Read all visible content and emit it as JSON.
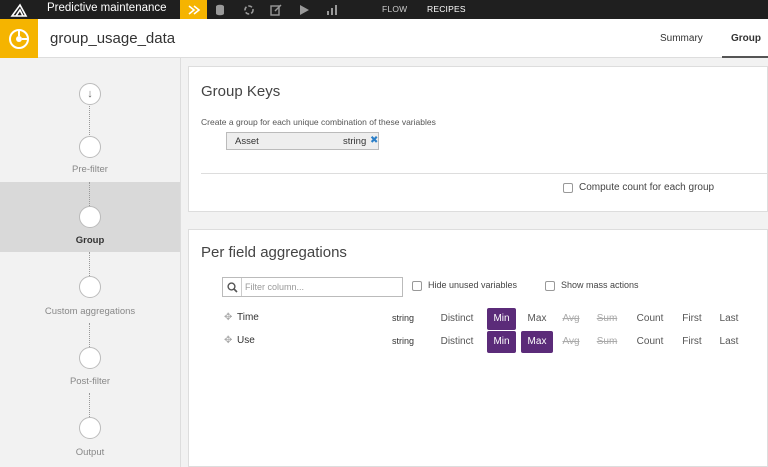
{
  "topbar": {
    "project_name": "Predictive maintenance",
    "nav": {
      "flow": "FLOW",
      "recipes": "RECIPES"
    },
    "icons": [
      "recipe-icon",
      "datasets-icon",
      "refresh-icon",
      "notebook-icon",
      "play-icon",
      "chart-icon"
    ]
  },
  "header": {
    "dataset_name": "group_usage_data",
    "tabs": {
      "summary": "Summary",
      "group": "Group"
    }
  },
  "steps": [
    {
      "label": ""
    },
    {
      "label": "Pre-filter"
    },
    {
      "label": "Group"
    },
    {
      "label": "Custom aggregations"
    },
    {
      "label": "Post-filter"
    },
    {
      "label": "Output"
    }
  ],
  "group_keys": {
    "title": "Group Keys",
    "hint": "Create a group for each unique combination of these variables",
    "key": {
      "name": "Asset",
      "type": "string"
    },
    "compute_count_label": "Compute count for each group"
  },
  "aggregations": {
    "title": "Per field aggregations",
    "filter_placeholder": "Filter column...",
    "hide_unused_label": "Hide unused variables",
    "show_mass_label": "Show mass actions",
    "fields": [
      {
        "name": "Time",
        "type": "string",
        "aggs": {
          "distinct": "Distinct",
          "min": "Min",
          "max": "Max",
          "avg": "Avg",
          "sum": "Sum",
          "count": "Count",
          "first": "First",
          "last": "Last"
        }
      },
      {
        "name": "Use",
        "type": "string",
        "aggs": {
          "distinct": "Distinct",
          "min": "Min",
          "max": "Max",
          "avg": "Avg",
          "sum": "Sum",
          "count": "Count",
          "first": "First",
          "last": "Last"
        }
      }
    ],
    "active": {
      "row0": [
        "min"
      ],
      "row1": [
        "min",
        "max"
      ]
    }
  },
  "colors": {
    "accent": "#f5b400",
    "selected": "#5b2b79",
    "topbar": "#1f1f1f"
  }
}
